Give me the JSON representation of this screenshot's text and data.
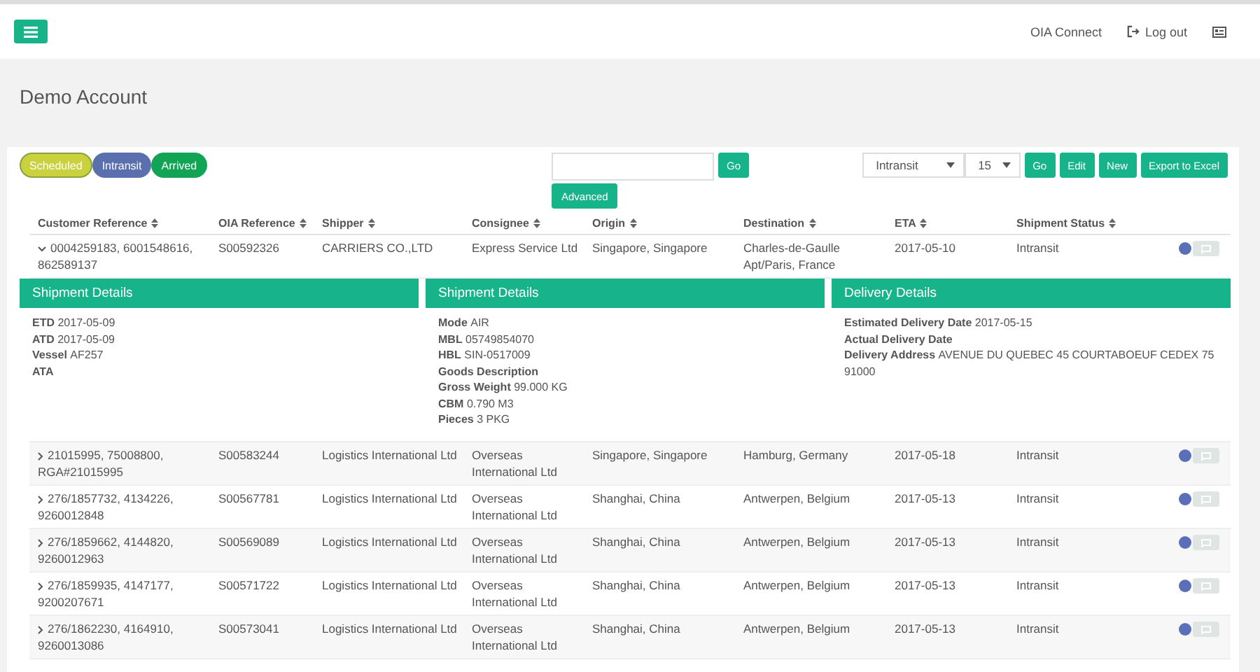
{
  "navbar": {
    "links": [
      "OIA Connect",
      "Log out"
    ]
  },
  "page_title": "Demo Account",
  "status_filters": [
    {
      "label": "Scheduled",
      "kind": "scheduled",
      "selected": true
    },
    {
      "label": "Intransit",
      "kind": "intransit",
      "selected": false
    },
    {
      "label": "Arrived",
      "kind": "arrived",
      "selected": false
    }
  ],
  "search": {
    "buttons": [
      "Go",
      "Advanced"
    ]
  },
  "status_select": {
    "value": "Intransit"
  },
  "page_size_select": {
    "value": "15"
  },
  "actions": [
    "Go",
    "Edit",
    "New",
    "Export to Excel"
  ],
  "table": {
    "columns": [
      "Customer Reference",
      "OIA Reference",
      "Shipper",
      "Consignee",
      "Origin",
      "Destination",
      "ETA",
      "Shipment Status"
    ],
    "rows": [
      {
        "expanded": true,
        "cells": [
          "0004259183, 6001548616, 862589137",
          "S00592326",
          "CARRIERS CO.,LTD",
          "Express Service Ltd",
          "Singapore, Singapore",
          "Charles-de-Gaulle Apt/Paris, France",
          "2017-05-10",
          "Intransit"
        ],
        "details": [
          {
            "title": "Shipment Details",
            "fields": [
              {
                "label": "ETD",
                "value": "2017-05-09"
              },
              {
                "label": "ATD",
                "value": "2017-05-09"
              },
              {
                "label": "Vessel",
                "value": "AF257"
              },
              {
                "label": "ATA"
              }
            ]
          },
          {
            "title": "Shipment Details",
            "fields": [
              {
                "label": "Mode",
                "value": "AIR"
              },
              {
                "label": "MBL",
                "value": "05749854070"
              },
              {
                "label": "HBL",
                "value": "SIN-0517009"
              },
              {
                "label": "Goods Description"
              },
              {
                "label": "Gross Weight",
                "value": "99.000 KG"
              },
              {
                "label": "CBM",
                "value": "0.790 M3"
              },
              {
                "label": "Pieces",
                "value": "3 PKG"
              }
            ]
          },
          {
            "title": "Delivery Details",
            "fields": [
              {
                "label": "Estimated Delivery Date",
                "value": "2017-05-15"
              },
              {
                "label": "Actual Delivery Date"
              },
              {
                "label": "Delivery Address",
                "value": "AVENUE DU QUEBEC 45 COURTABOEUF CEDEX 75 91000"
              }
            ]
          }
        ]
      },
      {
        "expanded": false,
        "cells": [
          "21015995, 75008800, RGA#21015995",
          "S00583244",
          "Logistics International Ltd",
          "Overseas International Ltd",
          "Singapore, Singapore",
          "Hamburg, Germany",
          "2017-05-18",
          "Intransit"
        ]
      },
      {
        "expanded": false,
        "cells": [
          "276/1857732, 4134226, 9260012848",
          "S00567781",
          "Logistics International Ltd",
          "Overseas International Ltd",
          "Shanghai, China",
          "Antwerpen, Belgium",
          "2017-05-13",
          "Intransit"
        ]
      },
      {
        "expanded": false,
        "cells": [
          "276/1859662, 4144820, 9260012963",
          "S00569089",
          "Logistics International Ltd",
          "Overseas International Ltd",
          "Shanghai, China",
          "Antwerpen, Belgium",
          "2017-05-13",
          "Intransit"
        ]
      },
      {
        "expanded": false,
        "cells": [
          "276/1859935, 4147177, 9200207671",
          "S00571722",
          "Logistics International Ltd",
          "Overseas International Ltd",
          "Shanghai, China",
          "Antwerpen, Belgium",
          "2017-05-13",
          "Intransit"
        ]
      },
      {
        "expanded": false,
        "cells": [
          "276/1862230, 4164910, 9260013086",
          "S00573041",
          "Logistics International Ltd",
          "Overseas International Ltd",
          "Shanghai, China",
          "Antwerpen, Belgium",
          "2017-05-13",
          "Intransit"
        ]
      }
    ]
  }
}
